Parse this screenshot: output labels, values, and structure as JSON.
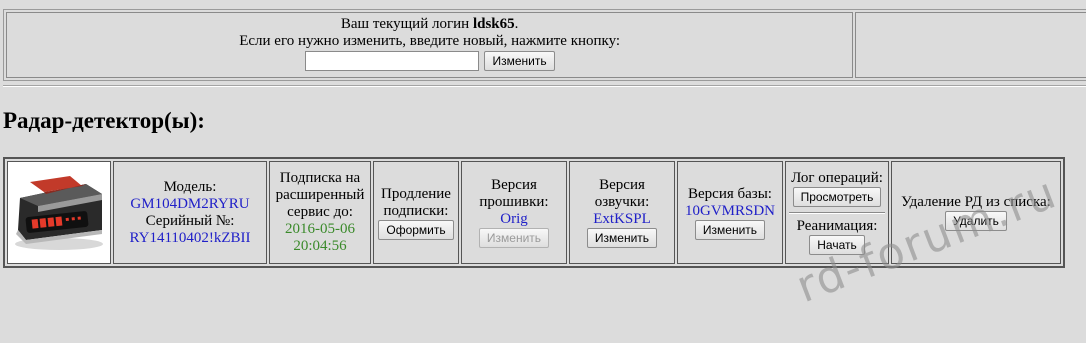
{
  "login": {
    "line1_prefix": "Ваш текущий логин",
    "username": "ldsk65",
    "line1_suffix": ".",
    "line2": "Если его нужно изменить, введите новый, нажмите кнопку:",
    "input_value": "",
    "change_button": "Изменить"
  },
  "section_title": "Радар-детектор(ы):",
  "device": {
    "photo_icon": "radar-detector-device",
    "model_label": "Модель:",
    "model_value": "GM104DM2RYRU",
    "serial_label": "Серийный №:",
    "serial_value": "RY14110402!kZBII",
    "subscription_label": "Подписка на расширенный сервис до:",
    "subscription_date": "2016-05-06",
    "subscription_time": "20:04:56",
    "renew_label": "Продление подписки:",
    "renew_button": "Оформить",
    "firmware_label": "Версия прошивки:",
    "firmware_value": "Orig",
    "firmware_button": "Изменить",
    "voice_label": "Версия озвучки:",
    "voice_value": "ExtKSPL",
    "voice_button": "Изменить",
    "db_label": "Версия базы:",
    "db_value": "10GVMRSDN",
    "db_button": "Изменить",
    "log_label": "Лог операций:",
    "log_button": "Просмотреть",
    "reanimation_label": "Реанимация:",
    "reanimation_button": "Начать",
    "delete_label": "Удаление РД из списка:",
    "delete_button": "Удалить"
  },
  "watermark": "rd-forum.ru"
}
